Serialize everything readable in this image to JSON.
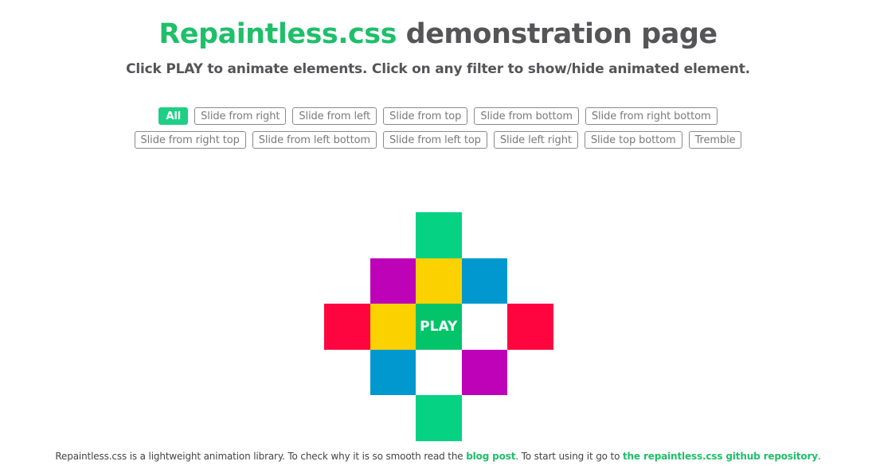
{
  "header": {
    "title_brand": "Repaintless.css",
    "title_rest": " demonstration page",
    "subtitle": "Click PLAY to animate elements. Click on any filter to show/hide animated element."
  },
  "filters": {
    "row1": [
      {
        "label": "All",
        "active": true
      },
      {
        "label": "Slide from right",
        "active": false
      },
      {
        "label": "Slide from left",
        "active": false
      },
      {
        "label": "Slide from top",
        "active": false
      },
      {
        "label": "Slide from bottom",
        "active": false
      },
      {
        "label": "Slide from right bottom",
        "active": false
      }
    ],
    "row2": [
      {
        "label": "Slide from right top",
        "active": false
      },
      {
        "label": "Slide from left bottom",
        "active": false
      },
      {
        "label": "Slide from left top",
        "active": false
      },
      {
        "label": "Slide left right",
        "active": false
      },
      {
        "label": "Slide top bottom",
        "active": false
      },
      {
        "label": "Tremble",
        "active": false
      }
    ]
  },
  "grid": {
    "play_label": "PLAY",
    "colors": {
      "green": "#05d283",
      "purple": "#bd02b8",
      "yellow": "#fbd100",
      "blue": "#0198cf",
      "red": "#ff053f",
      "play": "#04c46a"
    },
    "cells": [
      {
        "row": 0,
        "col": 2,
        "color": "green"
      },
      {
        "row": 1,
        "col": 1,
        "color": "purple"
      },
      {
        "row": 1,
        "col": 2,
        "color": "yellow"
      },
      {
        "row": 1,
        "col": 3,
        "color": "blue"
      },
      {
        "row": 2,
        "col": 0,
        "color": "red"
      },
      {
        "row": 2,
        "col": 1,
        "color": "yellow"
      },
      {
        "row": 2,
        "col": 2,
        "color": "play",
        "play": true
      },
      {
        "row": 2,
        "col": 4,
        "color": "red"
      },
      {
        "row": 3,
        "col": 1,
        "color": "blue"
      },
      {
        "row": 3,
        "col": 3,
        "color": "purple"
      },
      {
        "row": 4,
        "col": 2,
        "color": "green"
      }
    ]
  },
  "footer": {
    "text1": "Repaintless.css is a lightweight animation library. To check why it is so smooth read the ",
    "link1": "blog post",
    "text2": ". To start using it go to ",
    "link2": "the repaintless.css github repository",
    "text3": "."
  }
}
